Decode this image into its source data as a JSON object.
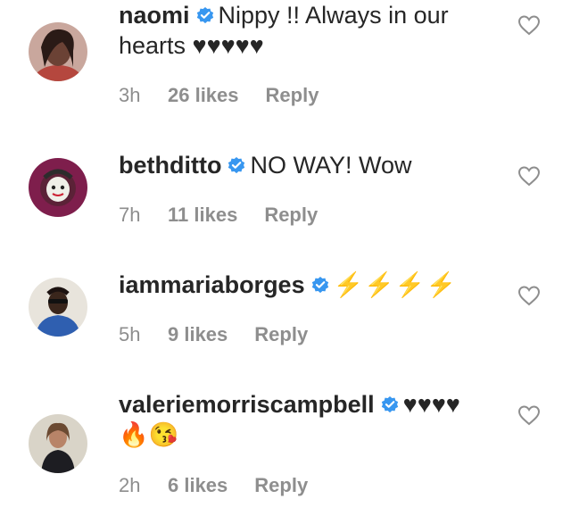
{
  "comments": [
    {
      "username": "naomi",
      "text": "Nippy !! Always in our hearts ♥♥♥♥♥",
      "time": "3h",
      "likes": "26 likes",
      "reply_label": "Reply",
      "avatar_icon": "avatar-naomi"
    },
    {
      "username": "bethditto",
      "text": "NO WAY! Wow",
      "time": "7h",
      "likes": "11 likes",
      "reply_label": "Reply",
      "avatar_icon": "avatar-bethditto"
    },
    {
      "username": "iammariaborges",
      "text": "⚡⚡⚡⚡",
      "time": "5h",
      "likes": "9 likes",
      "reply_label": "Reply",
      "avatar_icon": "avatar-iammariaborges"
    },
    {
      "username": "valeriemorriscampbell",
      "text": "♥♥♥♥ 🔥😘",
      "time": "2h",
      "likes": "6 likes",
      "reply_label": "Reply",
      "avatar_icon": "avatar-valeriemorriscampbell"
    }
  ],
  "colors": {
    "text": "#262626",
    "meta": "#8e8e8e",
    "verified": "#3897f0",
    "heart_outline": "#8e8e8e",
    "lightning": "#f4b400"
  },
  "icons": {
    "verified": "verified-badge-icon",
    "like": "heart-outline-icon"
  }
}
